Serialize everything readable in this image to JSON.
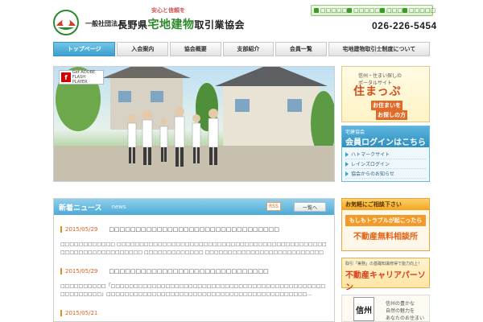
{
  "header": {
    "org_prefix": "一般社団法人",
    "org_name_a": "長野県",
    "org_name_accent": "宅地建物",
    "org_name_b": "取引業協会",
    "tagline": "安心と信頼を",
    "phone": "026-226-5454",
    "util_links": [
      {
        "label": "□□□□□",
        "icon": "lock-icon"
      },
      {
        "label": "□□□□□",
        "icon": "mail-icon"
      },
      {
        "label": "□□□",
        "icon": "map-icon"
      },
      {
        "label": "□□□□□",
        "icon": "sitemap-icon"
      }
    ]
  },
  "nav": {
    "items": [
      {
        "label": "トップページ",
        "active": true
      },
      {
        "label": "入会案内",
        "active": false
      },
      {
        "label": "協会概要",
        "active": false
      },
      {
        "label": "支部紹介",
        "active": false
      },
      {
        "label": "会員一覧",
        "active": false
      },
      {
        "label": "宅地建物取引士制度について",
        "active": false
      }
    ]
  },
  "hero": {
    "flash_line1": "Get ADOBE",
    "flash_line2": "FLASH PLAYER"
  },
  "side_banner": {
    "line1": "信州・住まい探しの",
    "line1b": "ポータルサイト",
    "logo_text": "住まっぷ",
    "btn1": "お住まいを",
    "btn2": "お探しの方"
  },
  "login": {
    "small": "宅建協会",
    "big": "会員ログインはこちら",
    "links": [
      "ハトマークサイト",
      "レインズログイン",
      "協会からのお知らせ"
    ]
  },
  "news": {
    "title": "新着ニュース",
    "title_en": "news",
    "rss": "RSS",
    "list_button": "一覧へ",
    "items": [
      {
        "date": "2015/05/29",
        "title": "□□□□□□□□□□□□□□□□□□□□□□□□□□□□□□□□",
        "text": "□□□□□□□□□□□□ □□□□□□□□□□□□□□□□□□□□□□□□□□□□□□□□□□□□□□□□□□□□□□□□□□□□□□□□□□□□□□□□ □□□□□□□□□□□□□ □□□□□□□□□□□□□□□□□□□□□□□□□□□□□□□□□□□□□□□..."
      },
      {
        "date": "2015/05/29",
        "title": "□□□□□□□□□□□□□□□□□□□□□□□□□□□□□□",
        "text": "□□□□□□□□□□「□□□□□□□□□□□□□□□□□□□□□□□□□□□□□□□□□□□□□□□□□□□□□□□□□□□□□□□□」□□□□□□□□□□□□□□□□□□□□□□□□□□□□□□□□□□□□□□□□□□□□..."
      },
      {
        "date": "2015/05/21",
        "title": "",
        "text": ""
      }
    ]
  },
  "consult": {
    "head": "お気軽にご相談下さい",
    "question": "もしもトラブルが起こったら",
    "answer": "不動産無料相談所"
  },
  "career": {
    "small": "取引「実務」の基礎知識修得で能力向上！",
    "big": "不動産キャリアパーソン"
  },
  "local": {
    "mark": "信州",
    "text1": "信州の豊かな",
    "text2": "自然の魅力を",
    "text3": "あなたのお住まい"
  },
  "colors": {
    "nav_active": "#3a9fcf",
    "accent_green": "#2c8a2c",
    "accent_orange": "#e88a1a"
  }
}
